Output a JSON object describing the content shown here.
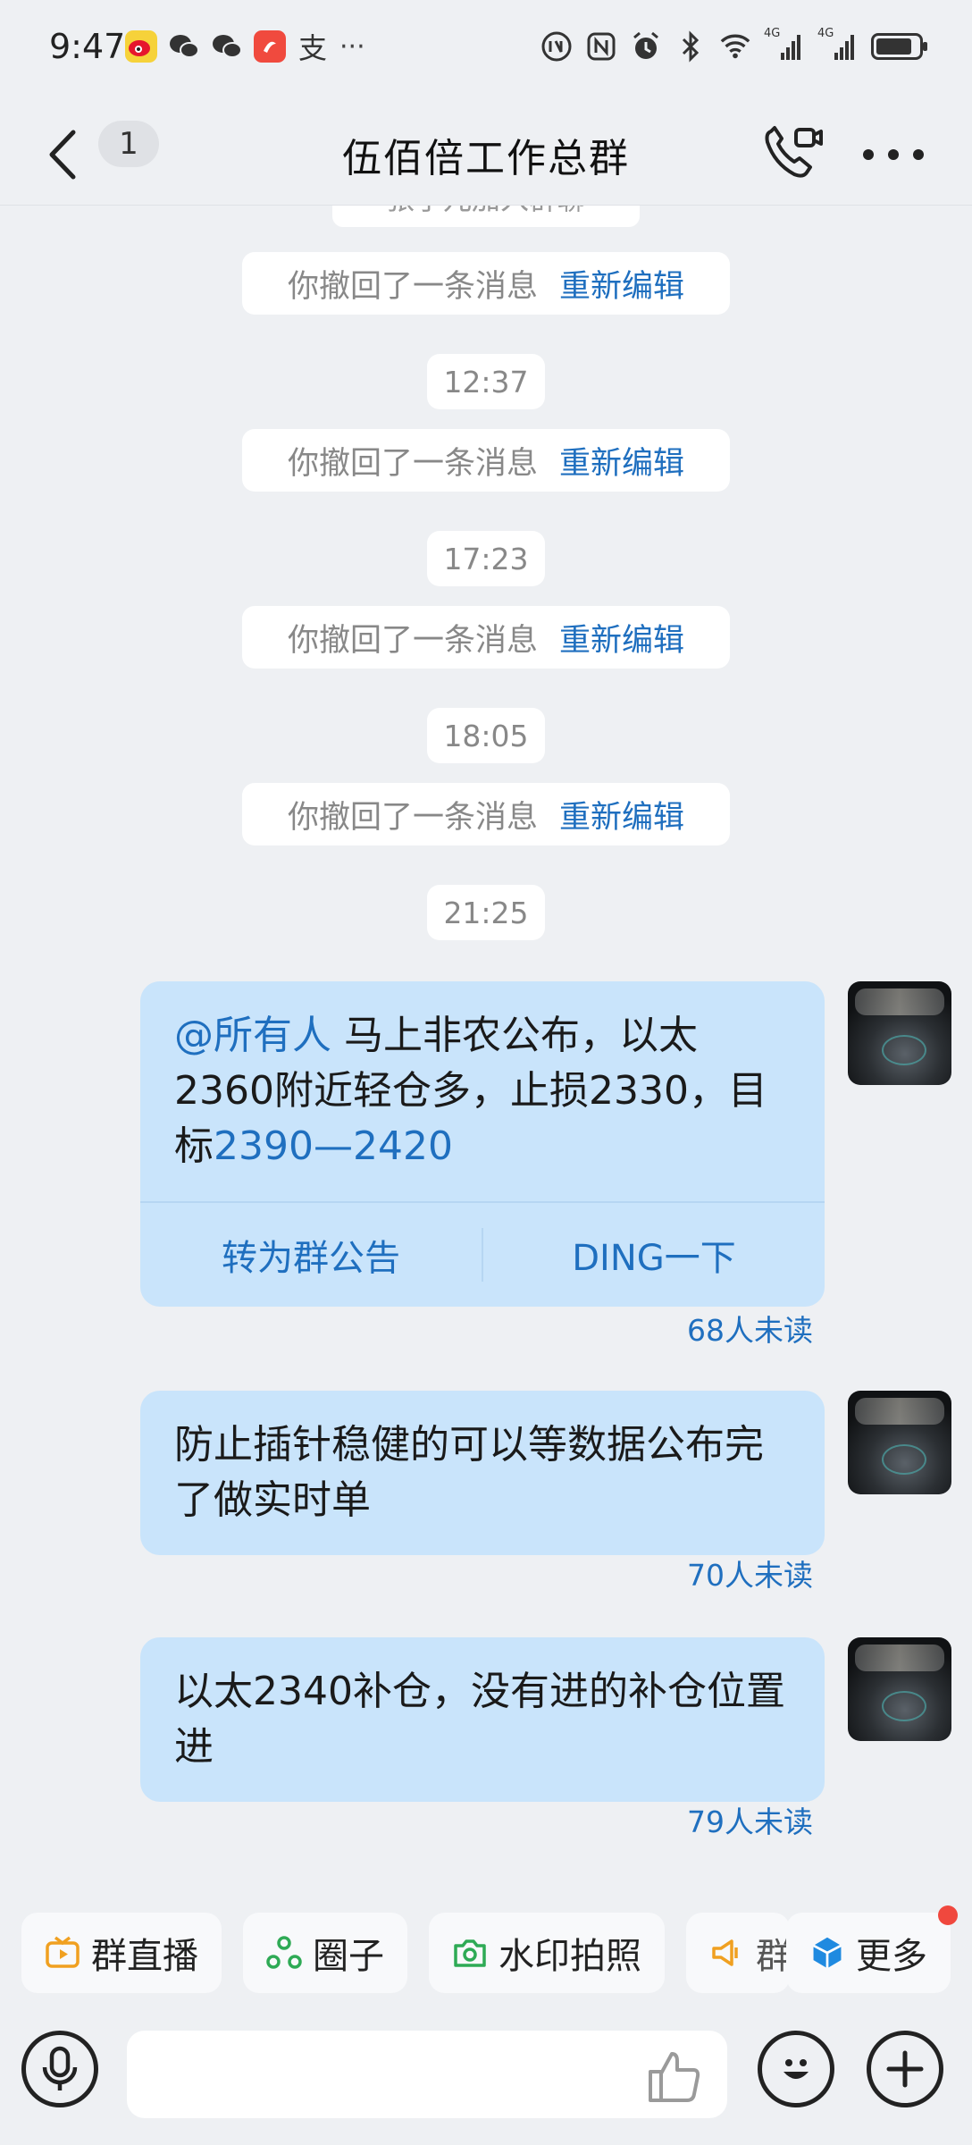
{
  "status_bar": {
    "time": "9:47",
    "app_icons": [
      "weibo-icon",
      "wechat-icon",
      "wechat-icon",
      "xiaohongshu-icon",
      "alipay-icon",
      "more-dots-icon"
    ],
    "more_apps": "···",
    "net_label_1": "4G",
    "net_label_2": "4G"
  },
  "nav": {
    "back_label": "<",
    "unread": "1",
    "title": "伍佰倍工作总群"
  },
  "chat": {
    "partial_notice": "张子兀加入群聊",
    "recalls": [
      {
        "text": "你撤回了一条消息",
        "action": "重新编辑"
      },
      {
        "text": "你撤回了一条消息",
        "action": "重新编辑"
      },
      {
        "text": "你撤回了一条消息",
        "action": "重新编辑"
      },
      {
        "text": "你撤回了一条消息",
        "action": "重新编辑"
      }
    ],
    "timestamps": [
      "12:37",
      "17:23",
      "18:05",
      "21:25"
    ],
    "messages": [
      {
        "mention": "@所有人",
        "text_a": " 马上非农公布，以太2360附近轻仓多，止损2330，目标",
        "text_link": "2390—2420",
        "action_left": "转为群公告",
        "action_right": "DING一下",
        "read_status": "68人未读"
      },
      {
        "text": "防止插针稳健的可以等数据公布完了做实时单",
        "read_status": "70人未读"
      },
      {
        "text": "以太2340补仓，没有进的补仓位置进",
        "read_status": "79人未读"
      }
    ]
  },
  "quick_actions": [
    {
      "label": "群直播",
      "icon": "live-tv-icon",
      "color": "#f0a020"
    },
    {
      "label": "圈子",
      "icon": "circle-group-icon",
      "color": "#2eaa55"
    },
    {
      "label": "水印拍照",
      "icon": "camera-icon",
      "color": "#2eaa55"
    },
    {
      "label": "群",
      "icon": "megaphone-icon",
      "color": "#f0a020"
    },
    {
      "label": "更多",
      "icon": "cube-icon",
      "color": "#1f8ae0"
    }
  ],
  "input": {
    "placeholder": ""
  }
}
